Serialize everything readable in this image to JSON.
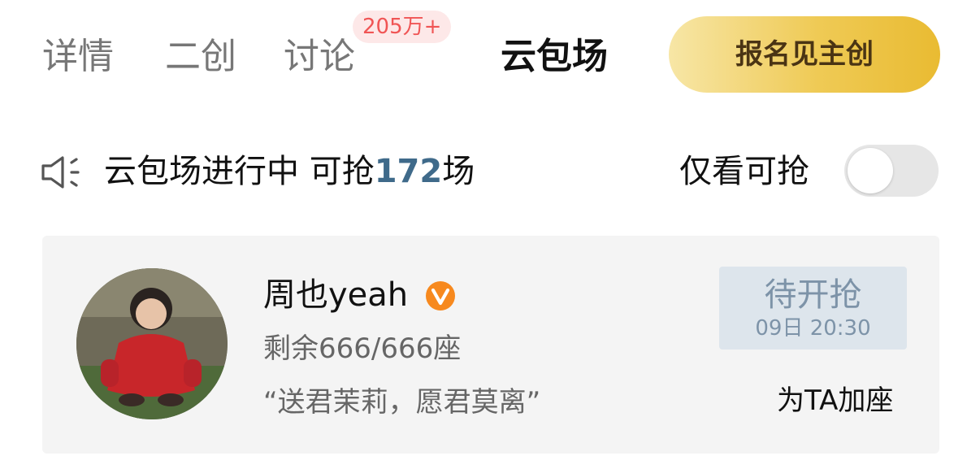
{
  "tabs": [
    {
      "label": "详情"
    },
    {
      "label": "二创"
    },
    {
      "label": "讨论",
      "badge": "205万+"
    },
    {
      "label": "云包场"
    }
  ],
  "header": {
    "cta_label": "报名见主创"
  },
  "notice": {
    "icon": "speaker-icon",
    "text_prefix": "云包场进行中 可抢",
    "count": "172",
    "text_suffix": "场",
    "count_color": "#3f6a8a"
  },
  "filter": {
    "label": "仅看可抢",
    "toggle_on": false
  },
  "card": {
    "user_name": "周也yeah",
    "verified_icon": "verified-v-badge-icon",
    "seats": "剩余666/666座",
    "quote": "“送君茉莉，愿君莫离”",
    "grab_label": "待开抢",
    "grab_time": "09日 20:30",
    "add_seat_label": "为TA加座"
  },
  "colors": {
    "cta_gradient_start": "#f7e6a6",
    "cta_gradient_end": "#e9bb32",
    "badge_text": "#f05555",
    "verified_orange": "#f7891e"
  }
}
